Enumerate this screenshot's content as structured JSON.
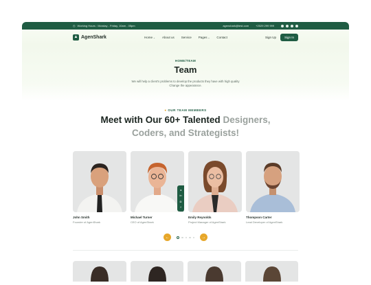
{
  "topbar": {
    "hours": "Working Hours : Monday - Friday, 10am - 05pm",
    "email": "agenshark@test.com",
    "phone": "+2029 299 999"
  },
  "nav": {
    "brand": "AgenShark",
    "items": [
      "Home",
      "About us",
      "Service",
      "Pages",
      "Contact"
    ],
    "signup": "Sign Up",
    "signin": "Sign In"
  },
  "hero": {
    "breadcrumb": "HOME/TEAM",
    "title": "Team",
    "description": "We will help a client's problems to develop the products they have with high quality Change the appearance."
  },
  "team": {
    "eyebrow": "OUR TEAM MEMBERS",
    "heading_main": "Meet with Our 60+ Talented",
    "heading_muted_1": "Designers,",
    "heading_muted_2": "Coders, and Strategists!",
    "members": [
      {
        "name": "John Smith",
        "role": "Founder of AgenShark"
      },
      {
        "name": "Michael Turner",
        "role": "CEO of AgenShark"
      },
      {
        "name": "Emily Reynolds",
        "role": "Project Manager of AgenShark"
      },
      {
        "name": "Thompson Carter",
        "role": "Lead Developer of AgenShark"
      }
    ]
  },
  "icons": {
    "clock": "clock-icon",
    "social": [
      "facebook-icon",
      "twitter-icon",
      "linkedin-icon",
      "instagram-icon"
    ],
    "share": [
      "telegram-icon",
      "linkedin-icon",
      "instagram-icon",
      "facebook-icon"
    ]
  },
  "colors": {
    "primary": "#1f5c43",
    "accent": "#e7a72a"
  }
}
